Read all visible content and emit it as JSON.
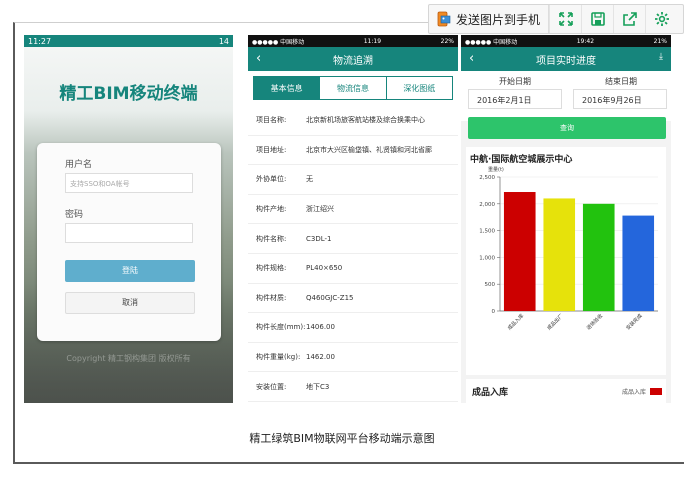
{
  "toolbar": {
    "send_label": "发送图片到手机",
    "icons": [
      "expand-icon",
      "save-icon",
      "share-icon",
      "settings-icon"
    ],
    "accent": "#16a05a"
  },
  "login_screen": {
    "status_time": "11:27",
    "status_battery": "14",
    "app_title": "精工BIM移动终端",
    "username_label": "用户名",
    "username_placeholder": "支持SSO和OA帐号",
    "password_label": "密码",
    "login_button": "登陆",
    "cancel_button": "取消",
    "footer": "Copyright 精工钢构集团 版权所有"
  },
  "trace_screen": {
    "status_carrier": "●●●●● 中国移动",
    "status_time": "11:19",
    "status_battery": "22%",
    "title": "物流追溯",
    "tabs": [
      "基本信息",
      "物流信息",
      "深化图纸"
    ],
    "rows": [
      {
        "key": "项目名称:",
        "value": "北京新机场旅客航站楼及综合换乘中心"
      },
      {
        "key": "项目地址:",
        "value": "北京市大兴区榆垡镇、礼贤镇和河北省廊"
      },
      {
        "key": "外协单位:",
        "value": "无"
      },
      {
        "key": "构件产地:",
        "value": "浙江绍兴"
      },
      {
        "key": "构件名称:",
        "value": "C3DL-1"
      },
      {
        "key": "构件规格:",
        "value": "PL40×650"
      },
      {
        "key": "构件材质:",
        "value": "Q460GJC-Z15"
      },
      {
        "key": "构件长度(mm):",
        "value": "1406.00"
      },
      {
        "key": "构件重量(kg):",
        "value": "1462.00"
      },
      {
        "key": "安装位置:",
        "value": "地下C3"
      }
    ]
  },
  "progress_screen": {
    "status_carrier": "●●●●● 中国移动",
    "status_time": "19:42",
    "status_battery": "21%",
    "title": "项目实时进度",
    "start_label": "开始日期",
    "start_value": "2016年2月1日",
    "end_label": "结束日期",
    "end_value": "2016年9月26日",
    "query_button": "查询",
    "chart_title": "中航·国际航空城展示中心",
    "bottom_title": "成品入库",
    "bottom_legend": "成品入库"
  },
  "chart_data": {
    "type": "bar",
    "title": "中航·国际航空城展示中心",
    "ylabel": "重量(t)",
    "ylim": [
      0,
      2500
    ],
    "yticks": [
      0,
      500,
      1000,
      1500,
      2000,
      2500
    ],
    "categories": [
      "成品入库",
      "成品出厂",
      "进场验收",
      "安装完成"
    ],
    "values": [
      2220,
      2100,
      2000,
      1780
    ],
    "colors": [
      "#cc0000",
      "#e6e20b",
      "#22c20e",
      "#2466dc"
    ],
    "grid": true
  },
  "caption": "精工绿筑BIM物联网平台移动端示意图"
}
